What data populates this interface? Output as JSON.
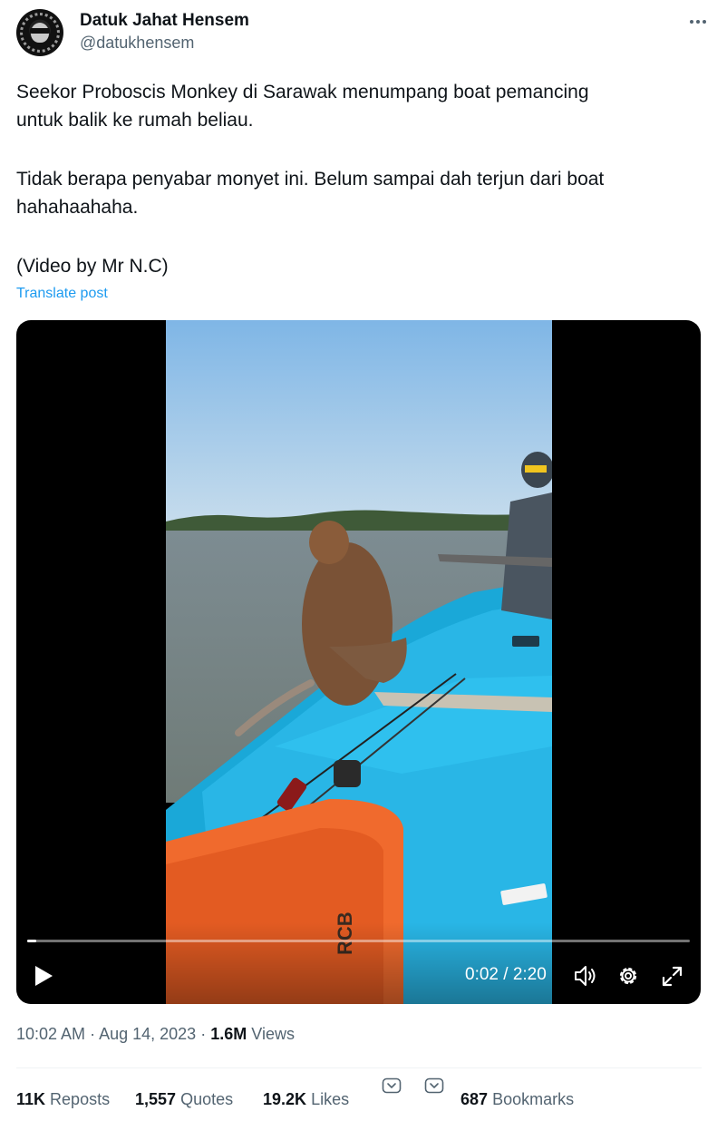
{
  "author": {
    "display_name": "Datuk Jahat Hensem",
    "handle": "@datukhensem"
  },
  "tweet": {
    "line1": "Seekor Proboscis Monkey di Sarawak menumpang boat pemancing",
    "line2": "untuk balik ke rumah beliau.",
    "line3": "Tidak berapa penyabar monyet ini. Belum sampai dah terjun dari boat",
    "line4": "hahahaahaha.",
    "line5": "(Video by Mr N.C)",
    "translate_label": "Translate post"
  },
  "video": {
    "time_display": "0:02 / 2:20",
    "progress_fraction": 0.014,
    "play_icon": "play-icon",
    "volume_icon": "volume-icon",
    "settings_icon": "gear-icon",
    "fullscreen_icon": "fullscreen-icon",
    "boat_label": "RCB"
  },
  "meta": {
    "time": "10:02 AM",
    "sep1": "·",
    "date": "Aug 14, 2023",
    "sep2": "·",
    "views_count": "1.6M",
    "views_label": "Views"
  },
  "stats": {
    "reposts_count": "11K",
    "reposts_label": "Reposts",
    "quotes_count": "1,557",
    "quotes_label": "Quotes",
    "likes_count": "19.2K",
    "likes_label": "Likes",
    "bookmarks_count": "687",
    "bookmarks_label": "Bookmarks"
  },
  "colors": {
    "link": "#1d9bf0",
    "secondary_text": "#536471",
    "primary_text": "#0f1419"
  }
}
